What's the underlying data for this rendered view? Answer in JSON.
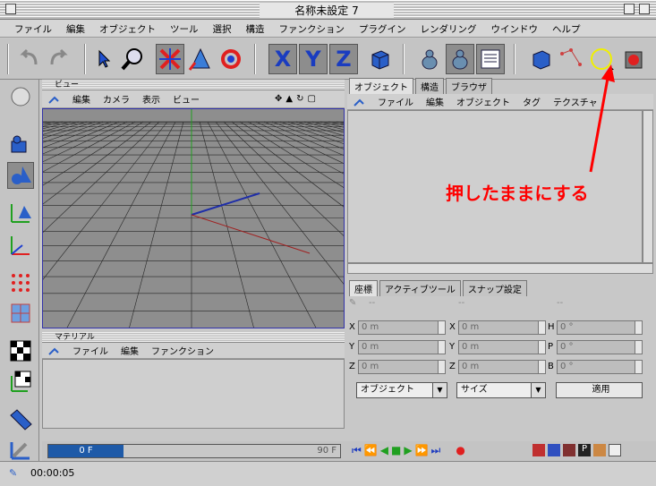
{
  "window": {
    "title": "名称未設定 7"
  },
  "menu": [
    "ファイル",
    "編集",
    "オブジェクト",
    "ツール",
    "選択",
    "構造",
    "ファンクション",
    "プラグイン",
    "レンダリング",
    "ウインドウ",
    "ヘルプ"
  ],
  "viewport": {
    "title": "ビュー",
    "menu": [
      "編集",
      "カメラ",
      "表示",
      "ビュー"
    ]
  },
  "material": {
    "title": "マテリアル",
    "menu": [
      "ファイル",
      "編集",
      "ファンクション"
    ]
  },
  "objects": {
    "tabs": [
      "オブジェクト",
      "構造",
      "ブラウザ"
    ],
    "menu": [
      "ファイル",
      "編集",
      "オブジェクト",
      "タグ",
      "テクスチャ"
    ]
  },
  "coords": {
    "tabs": [
      "座標",
      "アクティブツール",
      "スナップ設定"
    ],
    "dashes": [
      "--",
      "--",
      "--"
    ],
    "rows": [
      {
        "l1": "X",
        "v1": "0 m",
        "l2": "X",
        "v2": "0 m",
        "l3": "H",
        "v3": "0 °"
      },
      {
        "l1": "Y",
        "v1": "0 m",
        "l2": "Y",
        "v2": "0 m",
        "l3": "P",
        "v3": "0 °"
      },
      {
        "l1": "Z",
        "v1": "0 m",
        "l2": "Z",
        "v2": "0 m",
        "l3": "B",
        "v3": "0 °"
      }
    ],
    "mode_select": "オブジェクト",
    "size_select": "サイズ",
    "apply_label": "適用"
  },
  "timeline": {
    "current": "0 F",
    "end": "90 F"
  },
  "status": {
    "time": "00:00:05"
  },
  "annotation": {
    "text": "押したままにする",
    "color": "#ff0000",
    "circle_color": "#f0f000"
  },
  "axes": {
    "x_label": "X",
    "y_label": "Y",
    "z_label": "Z"
  }
}
